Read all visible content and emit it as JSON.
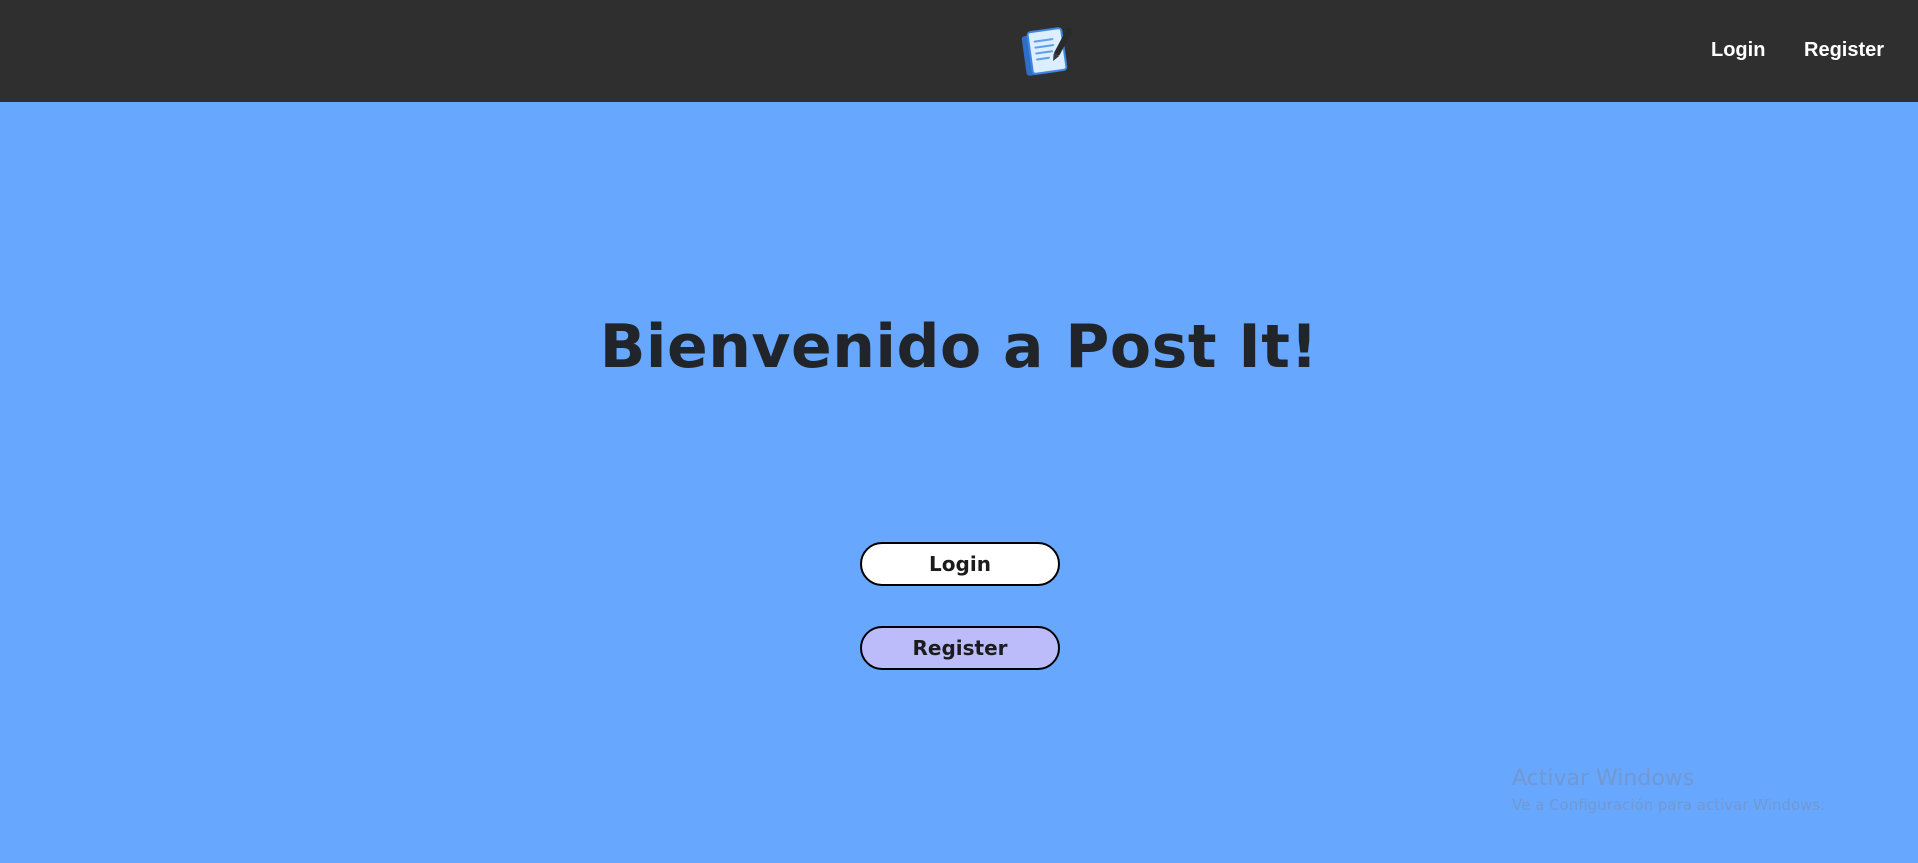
{
  "nav": {
    "login_label": "Login",
    "register_label": "Register",
    "logo_icon": "notepad-pen-icon"
  },
  "hero": {
    "title": "Bienvenido a Post It!"
  },
  "actions": {
    "login_label": "Login",
    "register_label": "Register"
  },
  "watermark": {
    "title": "Activar Windows",
    "subtitle": "Ve a Configuración para activar Windows."
  },
  "colors": {
    "topbar": "#2f2f2f",
    "background": "#68a7fe",
    "login_button": "#ffffff",
    "register_button": "#bcbcfb",
    "title_text": "#212529"
  }
}
